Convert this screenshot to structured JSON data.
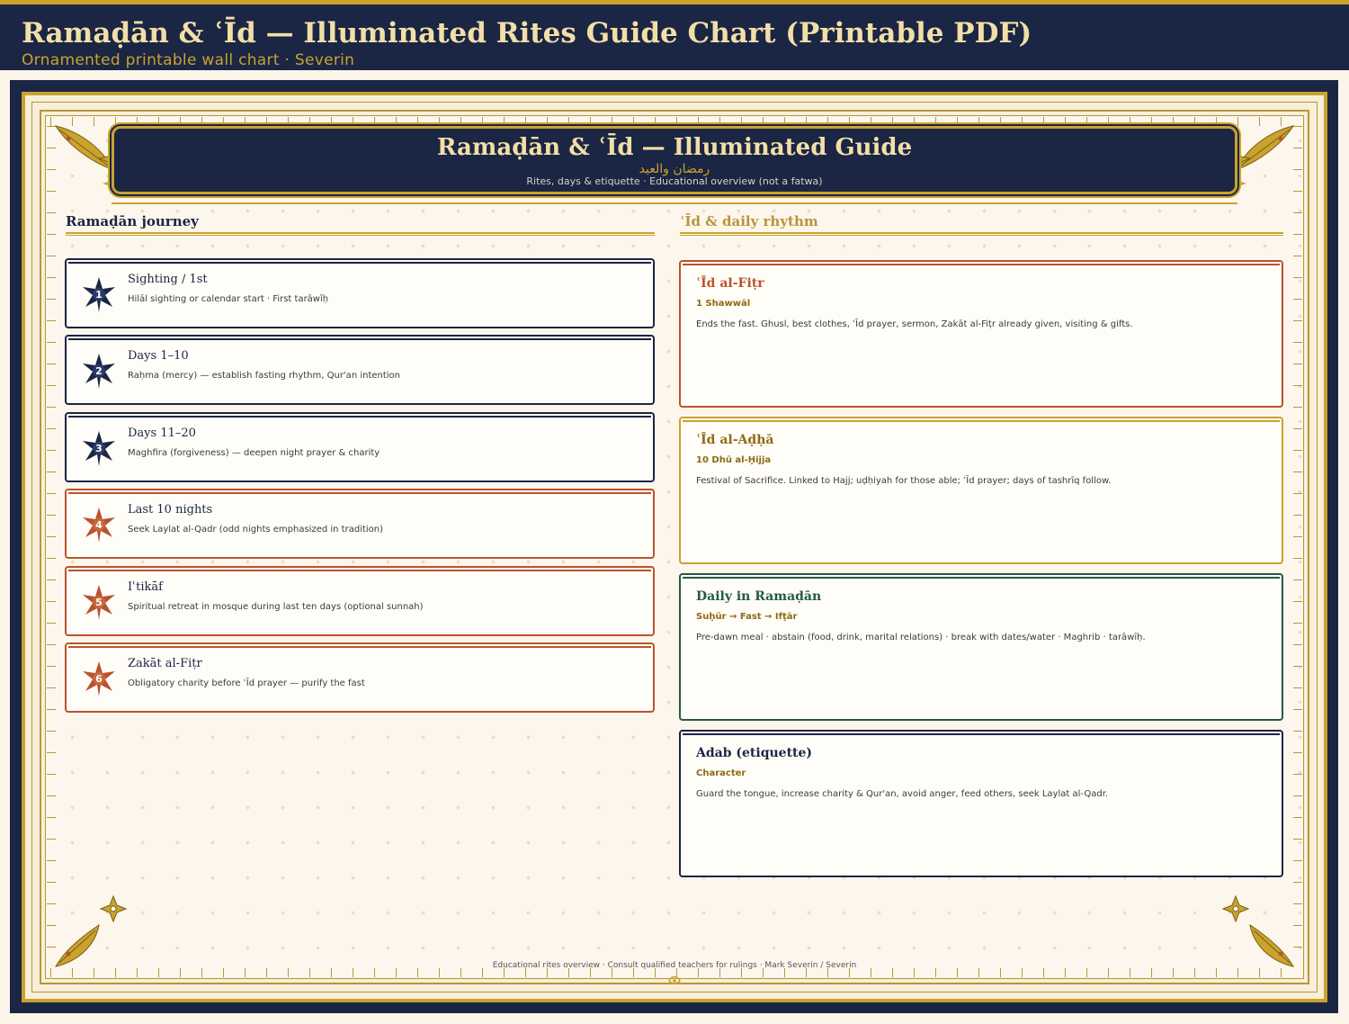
{
  "header": {
    "title": "Ramaḍān & ʿĪd — Illuminated Rites Guide Chart (Printable PDF)",
    "subtitle": "Ornamented printable wall chart · Severin"
  },
  "banner": {
    "title": "Ramaḍān & ʿĪd — Illuminated Guide",
    "arabic": "رمضان والعيد",
    "subtitle": "Rites, days & etiquette · Educational overview (not a fatwa)"
  },
  "left_column": {
    "heading": "Ramaḍān journey",
    "steps": [
      {
        "num": "1",
        "title": "Sighting / 1st",
        "desc": "Hilāl sighting or calendar start · First tarāwīḥ",
        "tone": "navy"
      },
      {
        "num": "2",
        "title": "Days 1–10",
        "desc": "Raḥma (mercy) — establish fasting rhythm, Qur'an intention",
        "tone": "navy"
      },
      {
        "num": "3",
        "title": "Days 11–20",
        "desc": "Maghfira (forgiveness) — deepen night prayer & charity",
        "tone": "navy"
      },
      {
        "num": "4",
        "title": "Last 10 nights",
        "desc": "Seek Laylat al-Qadr (odd nights emphasized in tradition)",
        "tone": "rust"
      },
      {
        "num": "5",
        "title": "Iʿtikāf",
        "desc": "Spiritual retreat in mosque during last ten days (optional sunnah)",
        "tone": "rust"
      },
      {
        "num": "6",
        "title": "Zakāt al-Fiṭr",
        "desc": "Obligatory charity before ʿĪd prayer — purify the fast",
        "tone": "rust"
      }
    ]
  },
  "right_column": {
    "heading": "ʿĪd & daily rhythm",
    "cards": [
      {
        "title": "ʿĪd al-Fiṭr",
        "subtitle": "1 Shawwāl",
        "desc": "Ends the fast. Ghusl, best clothes, ʿĪd prayer, sermon, Zakāt al-Fiṭr already given, visiting & gifts.",
        "tone": "rust"
      },
      {
        "title": "ʿĪd al-Aḍḥā",
        "subtitle": "10 Dhū al-Ḥijja",
        "desc": "Festival of Sacrifice. Linked to Hajj; uḍḥiyah for those able; ʿĪd prayer; days of tashrīq follow.",
        "tone": "gold"
      },
      {
        "title": "Daily in Ramaḍān",
        "subtitle": "Suḥūr → Fast → Ifṭār",
        "desc": "Pre-dawn meal · abstain (food, drink, marital relations) · break with dates/water · Maghrib · tarāwīḥ.",
        "tone": "green"
      },
      {
        "title": "Adab (etiquette)",
        "subtitle": "Character",
        "desc": "Guard the tongue, increase charity & Qur'an, avoid anger, feed others, seek Laylat al-Qadr.",
        "tone": "navy"
      }
    ]
  },
  "footer": {
    "text": "Educational rites overview · Consult qualified teachers for rulings · Mark Severin / Severin"
  },
  "colors": {
    "navy": "#1b2544",
    "gold": "#c9a32e",
    "rust": "#b9532e",
    "green": "#245a4a",
    "paper": "#fcf6ec"
  }
}
